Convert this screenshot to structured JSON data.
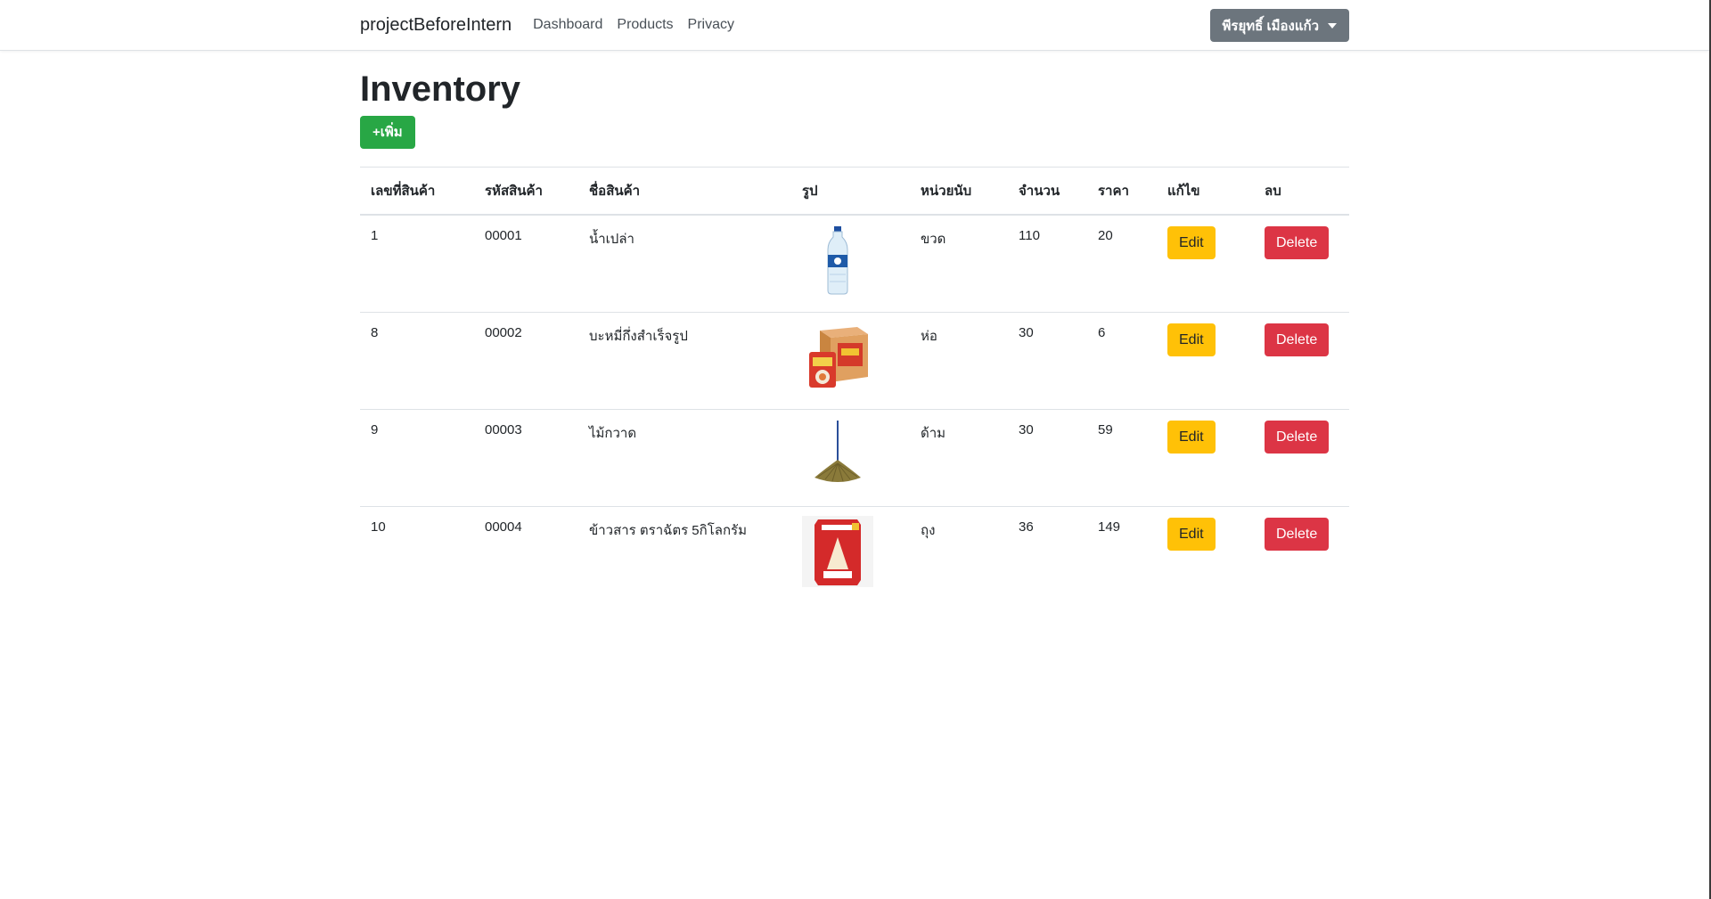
{
  "navbar": {
    "brand": "projectBeforeIntern",
    "links": [
      "Dashboard",
      "Products",
      "Privacy"
    ],
    "user_name": "พีรยุทธิ์ เมืองแก้ว"
  },
  "page": {
    "title": "Inventory",
    "add_button": "+เพิ่ม"
  },
  "table": {
    "headers": [
      "เลขที่สินค้า",
      "รหัสสินค้า",
      "ชื่อสินค้า",
      "รูป",
      "หน่วยนับ",
      "จำนวน",
      "ราคา",
      "แก้ไข",
      "ลบ"
    ],
    "rows": [
      {
        "id": "1",
        "code": "00001",
        "name": "น้ำเปล่า",
        "image": "water-bottle-image",
        "unit": "ขวด",
        "qty": "110",
        "price": "20",
        "edit": "Edit",
        "delete": "Delete"
      },
      {
        "id": "8",
        "code": "00002",
        "name": "บะหมี่กึ่งสำเร็จรูป",
        "image": "instant-noodle-image",
        "unit": "ห่อ",
        "qty": "30",
        "price": "6",
        "edit": "Edit",
        "delete": "Delete"
      },
      {
        "id": "9",
        "code": "00003",
        "name": "ไม้กวาด",
        "image": "broom-image",
        "unit": "ด้าม",
        "qty": "30",
        "price": "59",
        "edit": "Edit",
        "delete": "Delete"
      },
      {
        "id": "10",
        "code": "00004",
        "name": "ข้าวสาร ตราฉัตร 5กิโลกรัม",
        "image": "rice-bag-image",
        "unit": "ถุง",
        "qty": "36",
        "price": "149",
        "edit": "Edit",
        "delete": "Delete"
      }
    ]
  },
  "colors": {
    "add": "#28a745",
    "edit": "#ffc107",
    "delete": "#dc3545",
    "user_button": "#6c757d"
  }
}
